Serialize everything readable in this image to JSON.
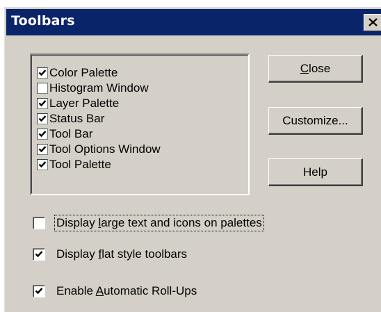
{
  "window": {
    "title": "Toolbars",
    "close_glyph": "close-icon"
  },
  "toolbar_list": {
    "items": [
      {
        "label": "Color Palette",
        "checked": true
      },
      {
        "label": "Histogram Window",
        "checked": false
      },
      {
        "label": "Layer Palette",
        "checked": true
      },
      {
        "label": "Status Bar",
        "checked": true
      },
      {
        "label": "Tool Bar",
        "checked": true
      },
      {
        "label": "Tool Options Window",
        "checked": true
      },
      {
        "label": "Tool Palette",
        "checked": true
      }
    ]
  },
  "buttons": {
    "close": {
      "accel": "C",
      "rest": "lose"
    },
    "customize": {
      "label": "Customize..."
    },
    "help": {
      "label": "Help"
    }
  },
  "options": [
    {
      "pre": "Display ",
      "accel": "l",
      "post": "arge text and icons on palettes",
      "checked": false
    },
    {
      "pre": "Display ",
      "accel": "f",
      "post": "lat style toolbars",
      "checked": true
    },
    {
      "pre": "Enable ",
      "accel": "A",
      "post": "utomatic Roll-Ups",
      "checked": true
    }
  ],
  "colors": {
    "titlebar": "#0a246a",
    "face": "#d4d0c8"
  }
}
